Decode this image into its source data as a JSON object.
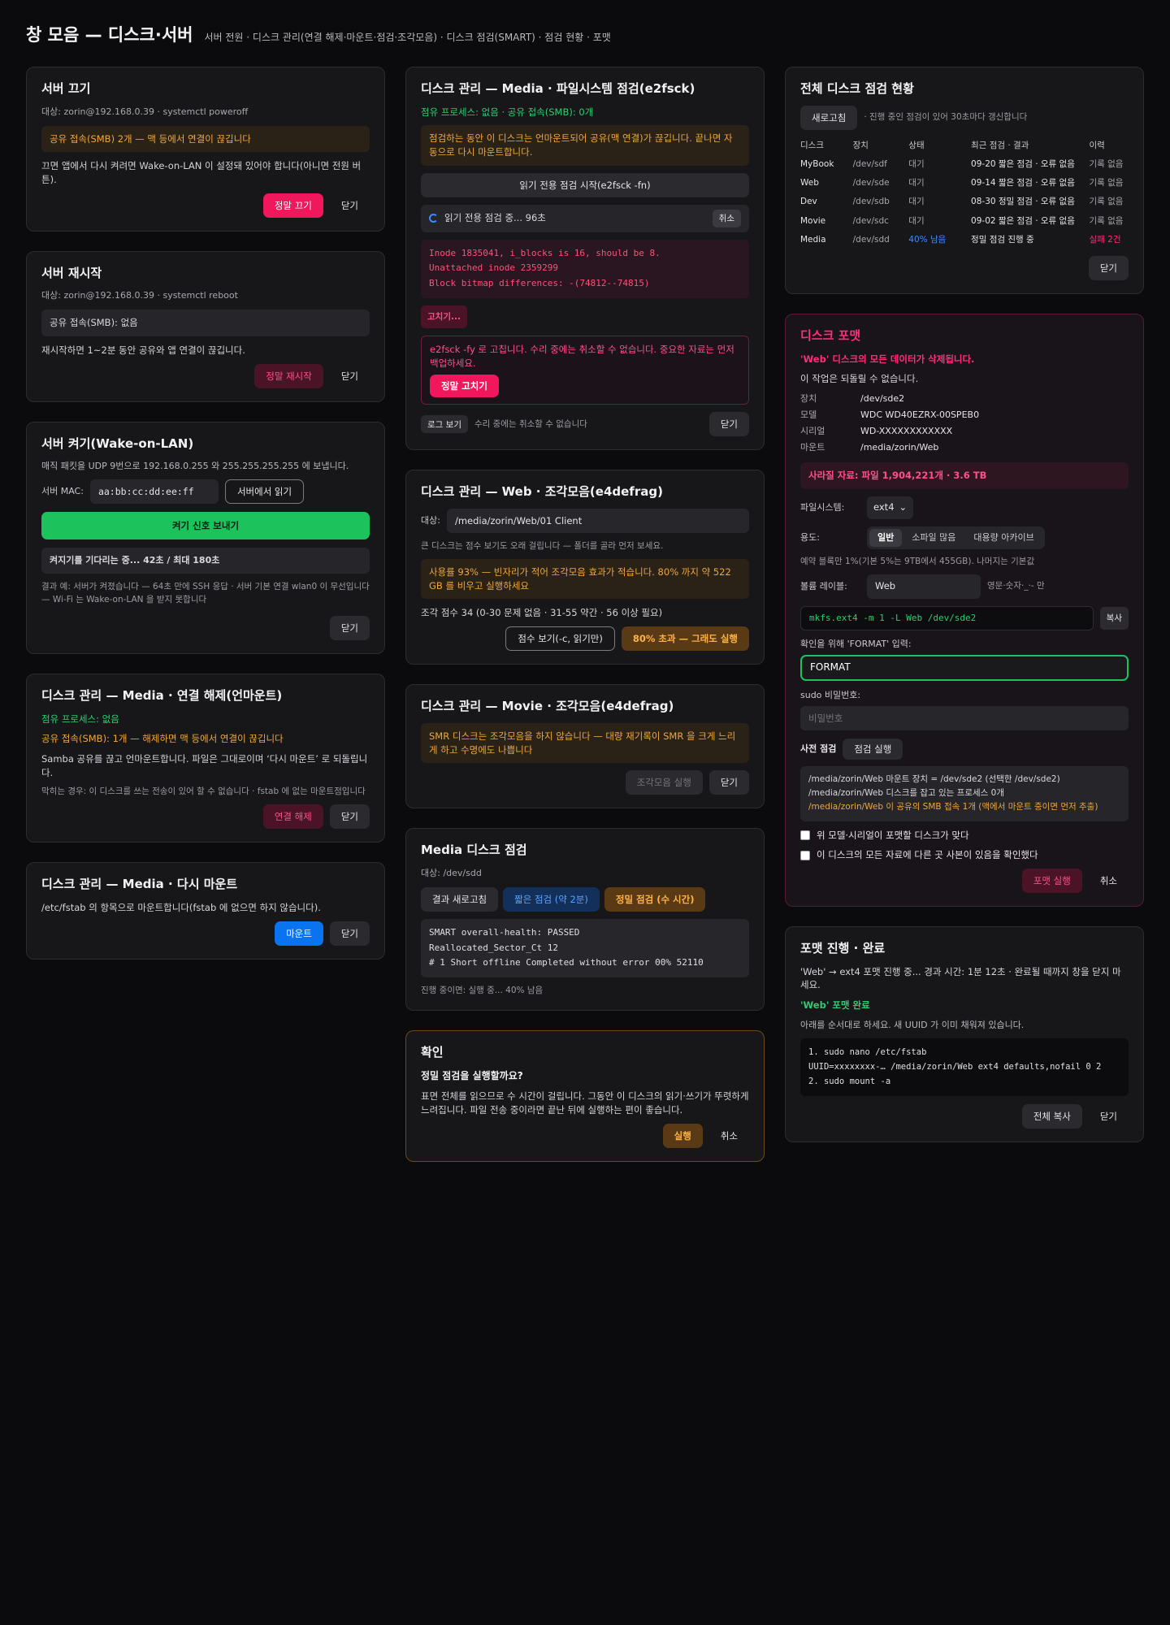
{
  "header": {
    "title": "창 모음 — 디스크·서버",
    "subtitle": "서버 전원 · 디스크 관리(연결 해제·마운트·점검·조각모음) · 디스크 점검(SMART) · 점검 현황 · 포맷"
  },
  "poweroff": {
    "title": "서버 끄기",
    "meta": "대상: zorin@192.168.0.39 · systemctl poweroff",
    "warn": "공유 접속(SMB) 2개 — 맥 등에서 연결이 끊깁니다",
    "desc": "끄면 앱에서 다시 켜려면 Wake-on-LAN 이 설정돼 있어야 합니다(아니면 전원 버튼).",
    "confirm": "정말 끄기",
    "close": "닫기"
  },
  "reboot": {
    "title": "서버 재시작",
    "meta": "대상: zorin@192.168.0.39 · systemctl reboot",
    "info": "공유 접속(SMB): 없음",
    "desc": "재시작하면 1~2분 동안 공유와 앱 연결이 끊깁니다.",
    "confirm": "정말 재시작",
    "close": "닫기"
  },
  "wol": {
    "title": "서버 켜기(Wake-on-LAN)",
    "desc": "매직 패킷을 UDP 9번으로 192.168.0.255 와 255.255.255.255 에 보냅니다.",
    "mac_label": "서버 MAC:",
    "mac_value": "aa:bb:cc:dd:ee:ff",
    "read_btn": "서버에서 읽기",
    "send_btn": "켜기 신호 보내기",
    "waiting": "켜지기를 기다리는 중... 42초 / 최대 180초",
    "note": "결과 예: 서버가 켜졌습니다 — 64초 만에 SSH 응답 · 서버 기본 연결 wlan0 이 무선입니다 — Wi-Fi 는 Wake-on-LAN 을 받지 못합니다",
    "close": "닫기"
  },
  "unmount": {
    "title": "디스크 관리 — Media · 연결 해제(언마운트)",
    "proc": "점유 프로세스: 없음",
    "smb": "공유 접속(SMB): 1개 — 해제하면 맥 등에서 연결이 끊깁니다",
    "desc": "Samba 공유를 끊고 언마운트합니다. 파일은 그대로이며 ‘다시 마운트’ 로 되돌립니다.",
    "note": "막히는 경우: 이 디스크를 쓰는 전송이 있어 할 수 없습니다 · fstab 에 없는 마운트점입니다",
    "confirm": "연결 해제",
    "close": "닫기"
  },
  "remount": {
    "title": "디스크 관리 — Media · 다시 마운트",
    "desc": "/etc/fstab 의 항목으로 마운트합니다(fstab 에 없으면 하지 않습니다).",
    "confirm": "마운트",
    "close": "닫기"
  },
  "fsck": {
    "title": "디스크 관리 — Media · 파일시스템 점검(e2fsck)",
    "status": "점유 프로세스: 없음 · 공유 접속(SMB): 0개",
    "warn": "점검하는 동안 이 디스크는 언마운트되어 공유(맥 연결)가 끊깁니다. 끝나면 자동으로 다시 마운트합니다.",
    "start_btn": "읽기 전용 점검 시작(e2fsck -fn)",
    "progress": "읽기 전용 점검 중... 96초",
    "cancel_sm": "취소",
    "errors": [
      "Inode 1835041, i_blocks is 16, should be 8.",
      "Unattached inode 2359299",
      "Block bitmap differences: -(74812--74815)"
    ],
    "fix_btn": "고치기...",
    "fix_warn": "e2fsck -fy 로 고칩니다. 수리 중에는 취소할 수 없습니다. 중요한 자료는 먼저 백업하세요.",
    "fix_confirm": "정말 고치기",
    "log_btn": "로그 보기",
    "log_note": "수리 중에는 취소할 수 없습니다",
    "close": "닫기"
  },
  "defrag_web": {
    "title": "디스크 관리 — Web · 조각모음(e4defrag)",
    "target_label": "대상:",
    "target_value": "/media/zorin/Web/01 Client",
    "note": "큰 디스크는 점수 보기도 오래 걸립니다 — 폴더를 골라 먼저 보세요.",
    "warn": "사용률 93% — 빈자리가 적어 조각모음 효과가 적습니다. 80% 까지 약 522 GB 를 비우고 실행하세요",
    "score": "조각 점수 34 (0-30 문제 없음 · 31-55 약간 · 56 이상 필요)",
    "score_btn": "점수 보기(-c, 읽기만)",
    "run_btn": "80% 초과 — 그래도 실행"
  },
  "defrag_movie": {
    "title": "디스크 관리 — Movie · 조각모음(e4defrag)",
    "warn": "SMR 디스크는 조각모음을 하지 않습니다 — 대량 재기록이 SMR 을 크게 느리게 하고 수명에도 나쁩니다",
    "run_btn": "조각모음 실행",
    "close": "닫기"
  },
  "smart": {
    "title": "Media 디스크 점검",
    "meta": "대상: /dev/sdd",
    "refresh_btn": "결과 새로고침",
    "short_btn": "짧은 점검 (약 2분)",
    "long_btn": "정밀 점검 (수 시간)",
    "output": [
      "SMART overall-health: PASSED",
      "Reallocated_Sector_Ct 12",
      "# 1 Short offline Completed without error 00% 52110"
    ],
    "progress": "진행 중이면: 실행 중... 40% 남음"
  },
  "confirm_dlg": {
    "title": "확인",
    "question": "정밀 점검을 실행할까요?",
    "desc": "표면 전체를 읽으므로 수 시간이 걸립니다. 그동안 이 디스크의 읽기·쓰기가 뚜렷하게 느려집니다. 파일 전송 중이라면 끝난 뒤에 실행하는 편이 좋습니다.",
    "run": "실행",
    "cancel": "취소"
  },
  "status": {
    "title": "전체 디스크 점검 현황",
    "refresh_btn": "새로고침",
    "refresh_note": "· 진행 중인 점검이 있어 30초마다 갱신합니다",
    "columns": [
      "디스크",
      "장치",
      "상태",
      "최근 점검 · 결과",
      "이력"
    ],
    "rows": [
      [
        "MyBook",
        "/dev/sdf",
        "대기",
        "09-20 짧은 점검 · 오류 없음",
        "기록 없음"
      ],
      [
        "Web",
        "/dev/sde",
        "대기",
        "09-14 짧은 점검 · 오류 없음",
        "기록 없음"
      ],
      [
        "Dev",
        "/dev/sdb",
        "대기",
        "08-30 정밀 점검 · 오류 없음",
        "기록 없음"
      ],
      [
        "Movie",
        "/dev/sdc",
        "대기",
        "09-02 짧은 점검 · 오류 없음",
        "기록 없음"
      ],
      [
        "Media",
        "/dev/sdd",
        "40% 남음",
        "정밀 점검 진행 중",
        "실패 2건"
      ]
    ],
    "close": "닫기"
  },
  "format": {
    "title": "디스크 포맷",
    "danger": "'Web' 디스크의 모든 데이터가 삭제됩니다.",
    "irreversible": "이 작업은 되돌릴 수 없습니다.",
    "info": [
      [
        "장치",
        "/dev/sde2"
      ],
      [
        "모델",
        "WDC WD40EZRX-00SPEB0"
      ],
      [
        "시리얼",
        "WD-XXXXXXXXXXXX"
      ],
      [
        "마운트",
        "/media/zorin/Web"
      ]
    ],
    "lost": "사라질 자료: 파일 1,904,221개 · 3.6 TB",
    "fs_label": "파일시스템:",
    "fs_value": "ext4",
    "usage_label": "용도:",
    "usage_opts": [
      "일반",
      "소파일 많음",
      "대용량 아카이브"
    ],
    "reserve_note": "예약 블록만 1%(기본 5%는 9TB에서 455GB). 나머지는 기본값",
    "vol_label": "볼륨 레이블:",
    "vol_value": "Web",
    "vol_hint": "영문·숫자·_·- 만",
    "command": "mkfs.ext4 -m 1 -L Web /dev/sde2",
    "copy_btn": "복사",
    "confirm_label": "확인을 위해 'FORMAT' 입력:",
    "confirm_value": "FORMAT",
    "sudo_label": "sudo 비밀번호:",
    "sudo_placeholder": "비밀번호",
    "precheck_label": "사전 점검",
    "precheck_btn": "점검 실행",
    "precheck_lines": [
      "/media/zorin/Web 마운트 장치 = /dev/sde2 (선택한 /dev/sde2)",
      "/media/zorin/Web 디스크를 잡고 있는 프로세스 0개",
      "/media/zorin/Web 이 공유의 SMB 접속 1개 (맥에서 마운트 중이면 먼저 추출)"
    ],
    "check1": "위 모델·시리얼이 포맷할 디스크가 맞다",
    "check2": "이 디스크의 모든 자료에 다른 곳 사본이 있음을 확인했다",
    "run_btn": "포맷 실행",
    "cancel": "취소"
  },
  "format_progress": {
    "title": "포맷 진행 · 완료",
    "desc": "'Web' → ext4 포맷 진행 중... 경과 시간: 1분 12초 · 완료될 때까지 창을 닫지 마세요.",
    "done": "'Web' 포맷 완료",
    "instr": "아래를 순서대로 하세요. 새 UUID 가 이미 채워져 있습니다.",
    "code": [
      "1. sudo nano /etc/fstab",
      "UUID=xxxxxxxx-… /media/zorin/Web ext4 defaults,nofail 0 2",
      "2. sudo mount -a"
    ],
    "copy_all": "전체 복사",
    "close": "닫기"
  }
}
